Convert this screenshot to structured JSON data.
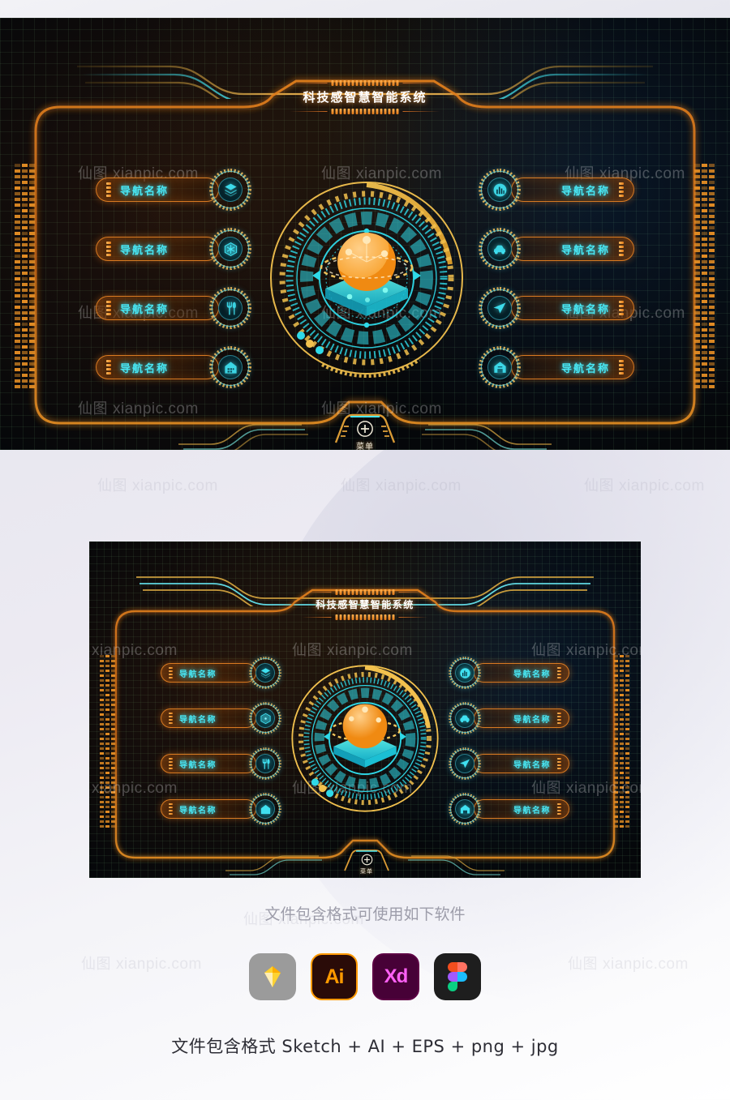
{
  "page": {
    "background_color": "#ecebf1",
    "accent_orange": "#e2801f",
    "accent_cyan": "#49e6f2",
    "accent_gold": "#f2c14e",
    "panel_bg": "#05070a"
  },
  "watermark": {
    "cn": "仙图",
    "en": "xianpic.com"
  },
  "app": {
    "title": "科技感智慧智能系统",
    "menu": {
      "label": "菜单",
      "icon": "plus-circle-icon"
    },
    "nav_left": [
      {
        "label": "导航名称",
        "icon": "layers-cube-icon"
      },
      {
        "label": "导航名称",
        "icon": "hexagon-network-icon"
      },
      {
        "label": "导航名称",
        "icon": "fork-utensils-icon"
      },
      {
        "label": "导航名称",
        "icon": "house-icon"
      }
    ],
    "nav_right": [
      {
        "label": "导航名称",
        "icon": "bar-chart-icon"
      },
      {
        "label": "导航名称",
        "icon": "car-icon"
      },
      {
        "label": "导航名称",
        "icon": "paper-plane-icon"
      },
      {
        "label": "导航名称",
        "icon": "home-building-icon"
      }
    ],
    "hud": {
      "name": "central-radar-hud",
      "sphere_color": "#f5a623",
      "platform_color": "#35d6d0",
      "ring_color_cyan": "#2fd9e8",
      "ring_color_gold": "#f2c14e",
      "dots": [
        "#2fd9e8",
        "#f2c14e",
        "#2fd9e8"
      ]
    }
  },
  "footer": {
    "note": "文件包含格式可使用如下软件",
    "software": [
      {
        "name": "Sketch",
        "label": ""
      },
      {
        "name": "Adobe Illustrator",
        "label": "Ai"
      },
      {
        "name": "Adobe XD",
        "label": "Xd"
      },
      {
        "name": "Figma",
        "label": ""
      }
    ],
    "formats": "文件包含格式 Sketch + AI + EPS + png + jpg"
  }
}
